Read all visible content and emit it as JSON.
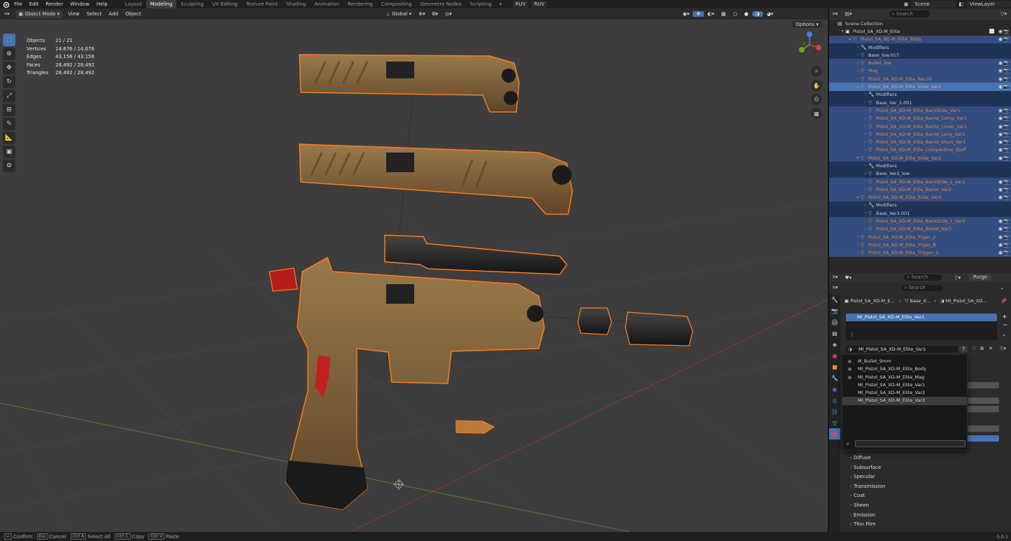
{
  "menu": [
    "File",
    "Edit",
    "Render",
    "Window",
    "Help"
  ],
  "workspaces": [
    "Layout",
    "Modeling",
    "Sculpting",
    "UV Editing",
    "Texture Paint",
    "Shading",
    "Animation",
    "Rendering",
    "Compositing",
    "Geometry Nodes",
    "Scripting"
  ],
  "active_workspace": "Modeling",
  "topright": {
    "scene": "Scene",
    "viewlayer": "ViewLayer",
    "undo1": "RUV",
    "undo2": "RUV"
  },
  "viewport_header": {
    "mode": "Object Mode",
    "view": "View",
    "select": "Select",
    "add": "Add",
    "object": "Object",
    "orientation": "Global",
    "options": "Options"
  },
  "stats": [
    {
      "label": "Objects",
      "value": "21 / 21"
    },
    {
      "label": "Vertices",
      "value": "14,676 / 14,676"
    },
    {
      "label": "Edges",
      "value": "43,156 / 43,156"
    },
    {
      "label": "Faces",
      "value": "28,492 / 28,492"
    },
    {
      "label": "Triangles",
      "value": "28,492 / 28,492"
    }
  ],
  "outliner": {
    "search_placeholder": "Search",
    "rows": [
      {
        "t": "Scene Collection",
        "d": 0,
        "tri": "",
        "c": "w",
        "s": ""
      },
      {
        "t": "Pistol_SA_XD-M_Elite",
        "d": 1,
        "tri": "v",
        "c": "w",
        "s": ""
      },
      {
        "t": "Pistol_SA_XD-M_Elite_Body",
        "d": 2,
        "tri": "v",
        "c": "o",
        "s": "sel"
      },
      {
        "t": "Modifiers",
        "d": 3,
        "tri": ">",
        "c": "w",
        "s": "sel2"
      },
      {
        "t": "Base_low.017",
        "d": 3,
        "tri": ">",
        "c": "w",
        "s": "sel2"
      },
      {
        "t": "Bullet_low",
        "d": 3,
        "tri": ">",
        "c": "o",
        "s": "sel"
      },
      {
        "t": "Mag",
        "d": 3,
        "tri": ">",
        "c": "o",
        "s": "sel"
      },
      {
        "t": "Pistol_SA_XD-M_Elite_Recoil",
        "d": 3,
        "tri": ">",
        "c": "o",
        "s": "sel"
      },
      {
        "t": "Pistol_SA_XD-M_Elite_Slide_Var1",
        "d": 3,
        "tri": "v",
        "c": "o",
        "s": "active"
      },
      {
        "t": "Modifiers",
        "d": 4,
        "tri": ">",
        "c": "w",
        "s": "sel2"
      },
      {
        "t": "Base_Var_1.001",
        "d": 4,
        "tri": ">",
        "c": "w",
        "s": "sel2"
      },
      {
        "t": "Pistol_SA_XD-M_Elite_BackSlide_Var1",
        "d": 4,
        "tri": ">",
        "c": "o",
        "s": "sel"
      },
      {
        "t": "Pistol_SA_XD-M_Elite_Barrel_Comp_Var1",
        "d": 4,
        "tri": ">",
        "c": "o",
        "s": "sel"
      },
      {
        "t": "Pistol_SA_XD-M_Elite_Barrel_Cover_Var1",
        "d": 4,
        "tri": ">",
        "c": "o",
        "s": "sel"
      },
      {
        "t": "Pistol_SA_XD-M_Elite_Barrel_Long_Var1",
        "d": 4,
        "tri": ">",
        "c": "o",
        "s": "sel"
      },
      {
        "t": "Pistol_SA_XD-M_Elite_Barrel_Short_Var1",
        "d": 4,
        "tri": ">",
        "c": "o",
        "s": "sel"
      },
      {
        "t": "Pistol_SA_XD-M_Elite_Competitive_Staff",
        "d": 4,
        "tri": ">",
        "c": "o",
        "s": "sel"
      },
      {
        "t": "Pistol_SA_XD-M_Elite_Slide_Var2",
        "d": 3,
        "tri": "v",
        "c": "o",
        "s": "sel"
      },
      {
        "t": "Modifiers",
        "d": 4,
        "tri": ">",
        "c": "w",
        "s": "sel2"
      },
      {
        "t": "Base_Var2_low",
        "d": 4,
        "tri": ">",
        "c": "w",
        "s": "sel2"
      },
      {
        "t": "Pistol_SA_XD-M_Elite_BackSlide_1_Var2",
        "d": 4,
        "tri": ">",
        "c": "o",
        "s": "sel"
      },
      {
        "t": "Pistol_SA_XD-M_Elite_Barrel_Var2",
        "d": 4,
        "tri": ">",
        "c": "o",
        "s": "sel"
      },
      {
        "t": "Pistol_SA_XD-M_Elite_Slide_Var3",
        "d": 3,
        "tri": "v",
        "c": "o",
        "s": "sel"
      },
      {
        "t": "Modifiers",
        "d": 4,
        "tri": ">",
        "c": "w",
        "s": "sel2"
      },
      {
        "t": "Base_Var3.001",
        "d": 4,
        "tri": ">",
        "c": "w",
        "s": "sel2"
      },
      {
        "t": "Pistol_SA_XD-M_Elite_BackSlide_1_Var3",
        "d": 4,
        "tri": ">",
        "c": "o",
        "s": "sel"
      },
      {
        "t": "Pistol_SA_XD-M_Elite_Barrel_Var3",
        "d": 4,
        "tri": ">",
        "c": "o",
        "s": "sel"
      },
      {
        "t": "Pistol_SA_XD-M_Elite_Triger_2",
        "d": 3,
        "tri": ">",
        "c": "o",
        "s": "sel"
      },
      {
        "t": "Pistol_SA_XD-M_Elite_Triger_B",
        "d": 3,
        "tri": ">",
        "c": "o",
        "s": "sel"
      },
      {
        "t": "Pistol_SA_XD-M_Elite_Trigger_1",
        "d": 3,
        "tri": ">",
        "c": "o",
        "s": "sel"
      }
    ]
  },
  "properties": {
    "purge": "Purge",
    "search_placeholder": "Search",
    "breadcrumb": [
      "Pistol_SA_XD-M_E...",
      "Base_V...",
      "MI_Pistol_SA_XD..."
    ],
    "active_slot": "MI_Pistol_SA_XD-M_Elite_Var1",
    "material_field": "MI_Pistol_SA_XD-M_Elite_Var1",
    "user_count": "7",
    "sections": [
      "Diffuse",
      "Subsurface",
      "Specular",
      "Transmission",
      "Coat",
      "Sheen",
      "Emission",
      "Thin Film"
    ]
  },
  "dropdown": {
    "items": [
      "M_Bullet_9mm",
      "MI_Pistol_SA_XD-M_Elite_Body",
      "MI_Pistol_SA_XD-M_Elite_Mag",
      "MI_Pistol_SA_XD-M_Elite_Var1",
      "MI_Pistol_SA_XD-M_Elite_Var2",
      "MI_Pistol_SA_XD-M_Elite_Var3"
    ],
    "highlighted": 5
  },
  "statusbar": [
    {
      "key": "↵",
      "label": "Confirm"
    },
    {
      "key": "Esc",
      "label": "Cancel"
    },
    {
      "key": "Ctrl A",
      "label": "Select All"
    },
    {
      "key": "Ctrl C",
      "label": "Copy"
    },
    {
      "key": "Ctrl V",
      "label": "Paste"
    }
  ],
  "version": "5.0.1",
  "colors": {
    "accent": "#4772b3",
    "selection": "#e8883a",
    "outline": "#ff7a1a",
    "gun": "#8a6a40"
  }
}
